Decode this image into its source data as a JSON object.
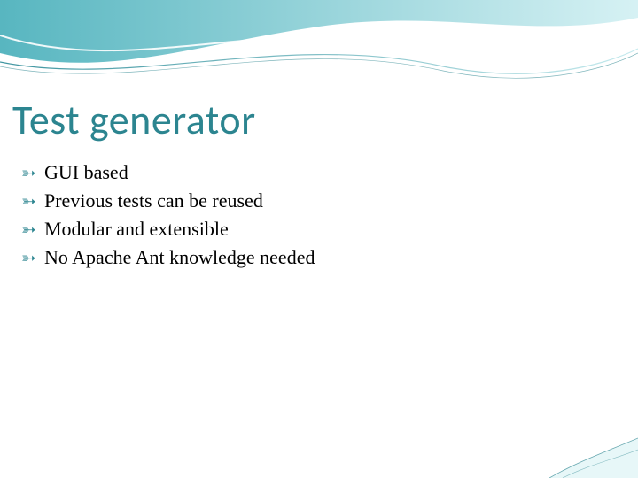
{
  "title": "Test generator",
  "bullets": [
    "GUI based",
    "Previous tests can be reused",
    "Modular and extensible",
    "No Apache Ant knowledge needed"
  ],
  "colors": {
    "title": "#2c8590",
    "bullet": "#2c8590",
    "body_text": "#000000"
  }
}
